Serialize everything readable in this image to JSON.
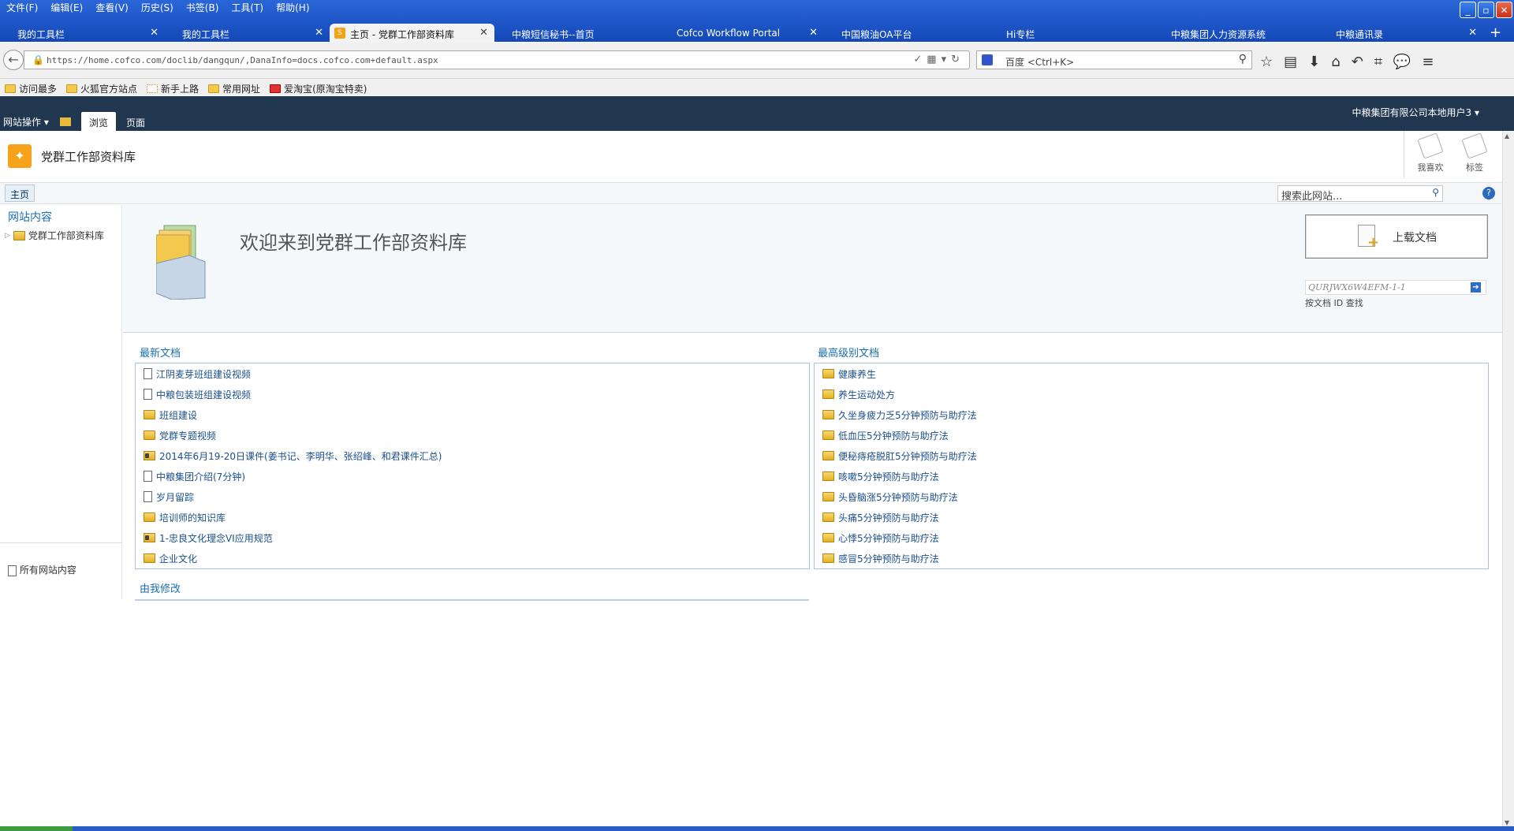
{
  "browser": {
    "menu": [
      "文件(F)",
      "编辑(E)",
      "查看(V)",
      "历史(S)",
      "书签(B)",
      "工具(T)",
      "帮助(H)"
    ],
    "tabs": [
      {
        "label": "我的工具栏"
      },
      {
        "label": "我的工具栏"
      },
      {
        "label": "主页 - 党群工作部资料库",
        "active": true
      },
      {
        "label": "中粮短信秘书--首页"
      },
      {
        "label": "Cofco Workflow Portal"
      },
      {
        "label": "中国粮油OA平台"
      },
      {
        "label": "Hi专栏"
      },
      {
        "label": "中粮集团人力资源系统"
      },
      {
        "label": "中粮通讯录"
      }
    ],
    "url": "https://home.cofco.com/doclib/dangqun/,DanaInfo=docs.cofco.com+default.aspx",
    "search_engine": "百度 <Ctrl+K>",
    "bookmarks": [
      "访问最多",
      "火狐官方站点",
      "新手上路",
      "常用网址",
      "爱淘宝(原淘宝特卖)"
    ]
  },
  "ribbon": {
    "site_actions": "网站操作",
    "tabs": [
      "浏览",
      "页面"
    ],
    "user": "中粮集团有限公司本地用户3"
  },
  "site": {
    "title": "党群工作部资料库",
    "like": "我喜欢",
    "tags": "标签",
    "home_tab": "主页",
    "search_placeholder": "搜索此网站...",
    "help": "?"
  },
  "leftnav": {
    "heading": "网站内容",
    "item": "党群工作部资料库",
    "all_content": "所有网站内容"
  },
  "welcome": {
    "title": "欢迎来到党群工作部资料库",
    "upload": "上载文档",
    "doc_id_value": "QURJWX6W4EFM-1-1",
    "doc_id_label": "按文档 ID 查找"
  },
  "recent": {
    "title": "最新文档",
    "items": [
      {
        "label": "江阴麦芽班组建设视频",
        "icon": "doc-icon"
      },
      {
        "label": "中粮包装班组建设视频",
        "icon": "doc-icon"
      },
      {
        "label": "班组建设",
        "icon": "folder-icon"
      },
      {
        "label": "党群专题视频",
        "icon": "folder-icon"
      },
      {
        "label": "2014年6月19-20日课件(姜书记、李明华、张绍峰、和君课件汇总)",
        "icon": "locked-folder-icon"
      },
      {
        "label": "中粮集团介绍(7分钟)",
        "icon": "doc-icon"
      },
      {
        "label": "岁月留踪",
        "icon": "doc-icon"
      },
      {
        "label": "培训师的知识库",
        "icon": "folder-icon"
      },
      {
        "label": "1-忠良文化理念VI应用规范",
        "icon": "locked-folder-icon"
      },
      {
        "label": "企业文化",
        "icon": "folder-icon"
      }
    ]
  },
  "top": {
    "title": "最高级别文档",
    "items": [
      {
        "label": "健康养生",
        "highlight": true
      },
      {
        "label": "养生运动处方"
      },
      {
        "label": "久坐身疲力乏5分钟预防与助疗法"
      },
      {
        "label": "低血压5分钟预防与助疗法"
      },
      {
        "label": "便秘痔疮脱肛5分钟预防与助疗法"
      },
      {
        "label": "咳嗽5分钟预防与助疗法"
      },
      {
        "label": "头昏脑涨5分钟预防与助疗法"
      },
      {
        "label": "头痛5分钟预防与助疗法"
      },
      {
        "label": "心悸5分钟预防与助疗法"
      },
      {
        "label": "感冒5分钟预防与助疗法"
      }
    ]
  },
  "mine": {
    "title": "由我修改"
  },
  "colors": {
    "ribbon": "#21364f",
    "link": "#1b4f8a",
    "accent": "#1a6fb2",
    "highlight": "#b20046"
  }
}
